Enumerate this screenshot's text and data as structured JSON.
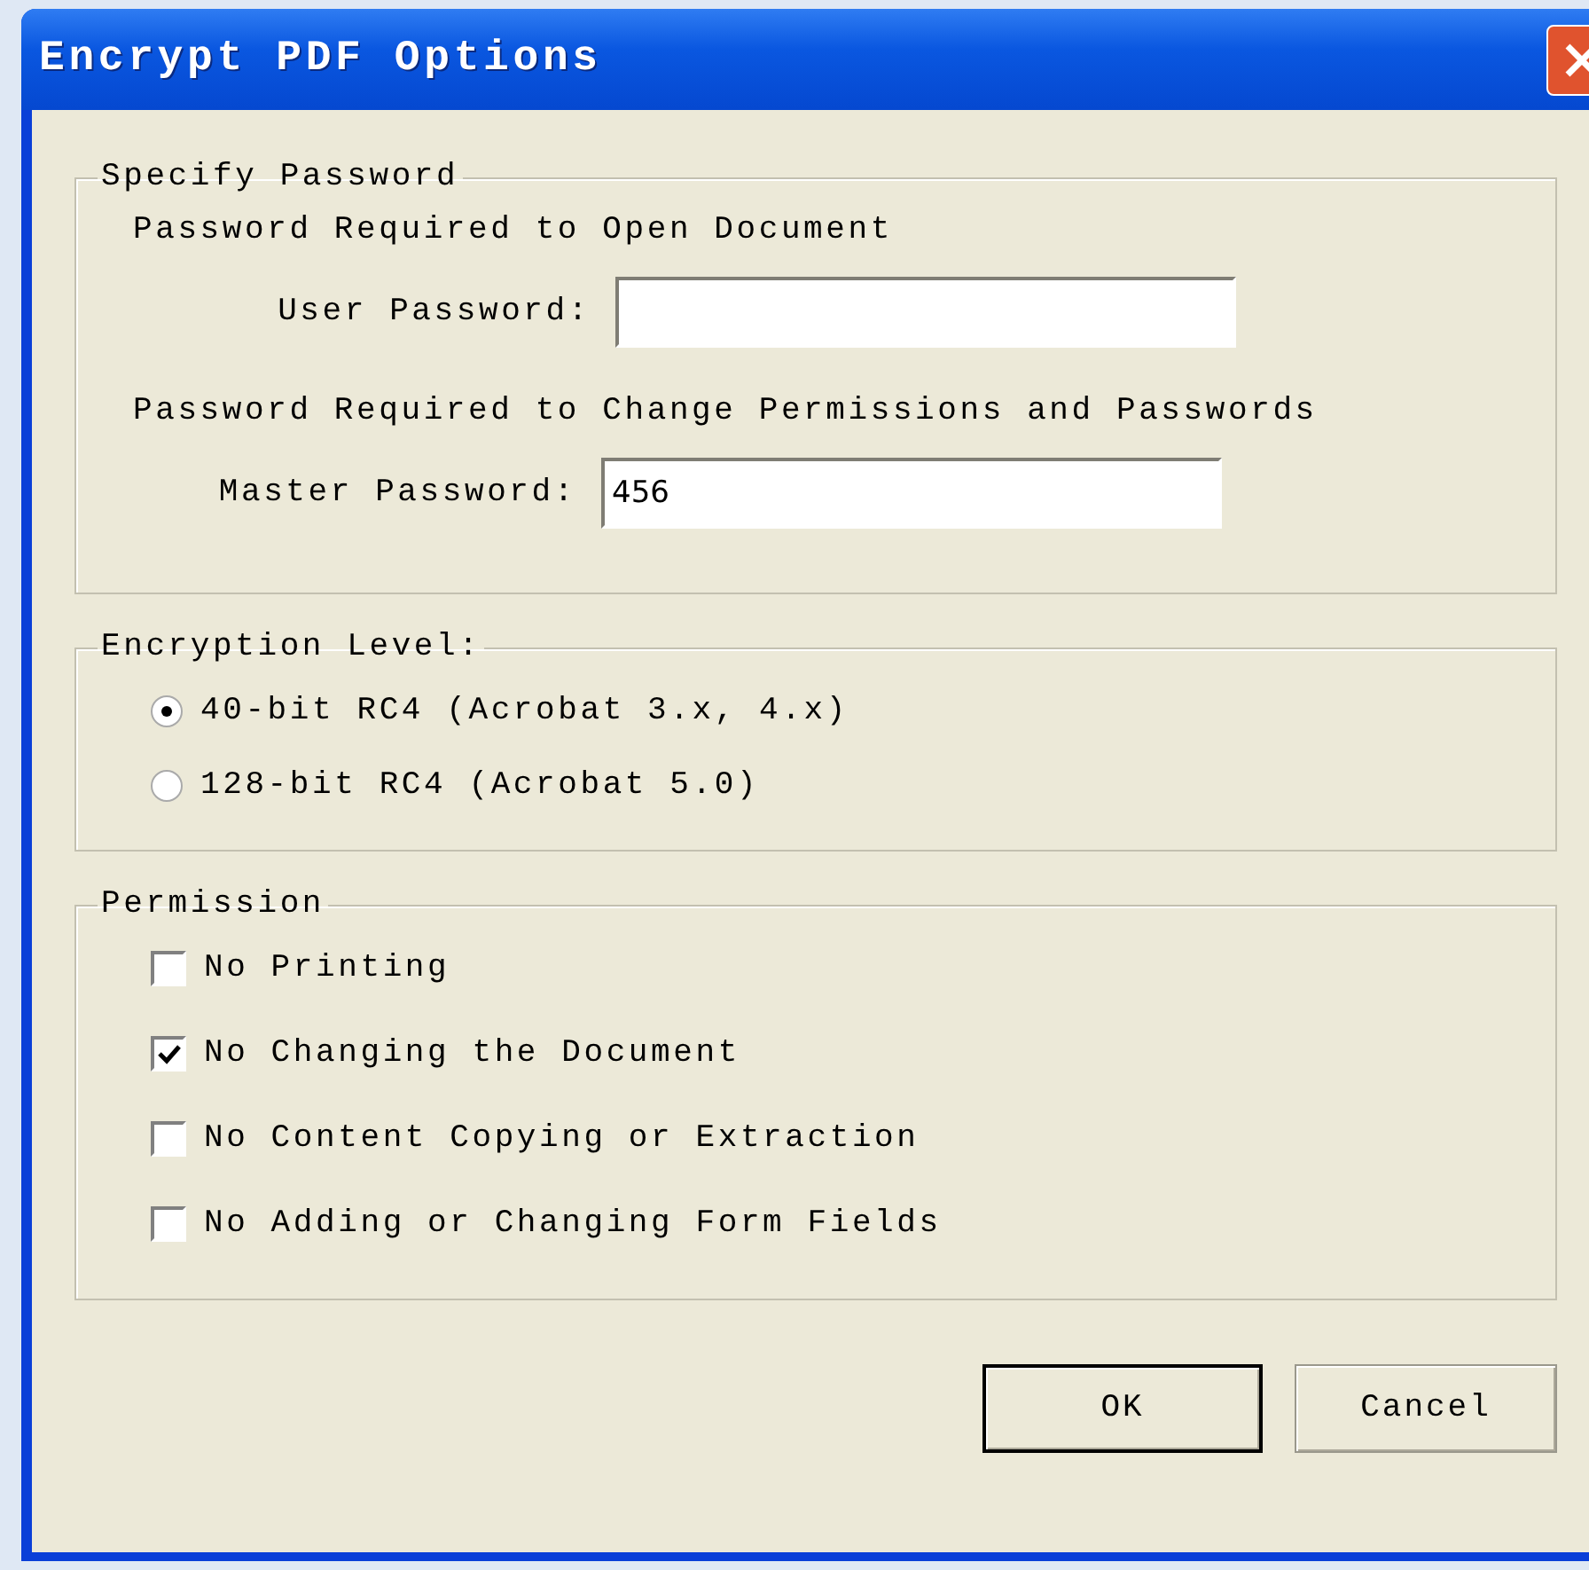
{
  "window": {
    "title": "Encrypt PDF Options"
  },
  "specify_password": {
    "title": "Specify Password",
    "sections": [
      {
        "heading": "Password Required to Open Document",
        "label": "User Password:"
      },
      {
        "heading": "Password Required to Change Permissions and Passwords",
        "label": "Master Password:",
        "value": "456"
      }
    ]
  },
  "encryption_level": {
    "title": "Encryption Level:",
    "options": [
      {
        "label": "40-bit RC4 (Acrobat 3.x, 4.x)",
        "selected": true
      },
      {
        "label": "128-bit RC4 (Acrobat 5.0)",
        "selected": false
      }
    ]
  },
  "permission": {
    "title": "Permission",
    "options": [
      {
        "label": "No Printing",
        "checked": false
      },
      {
        "label": "No Changing the Document",
        "checked": true
      },
      {
        "label": "No Content Copying or Extraction",
        "checked": false
      },
      {
        "label": "No Adding or Changing Form Fields",
        "checked": false
      }
    ]
  },
  "buttons": [
    {
      "label": "OK",
      "default": true
    },
    {
      "label": "Cancel",
      "default": false
    }
  ]
}
